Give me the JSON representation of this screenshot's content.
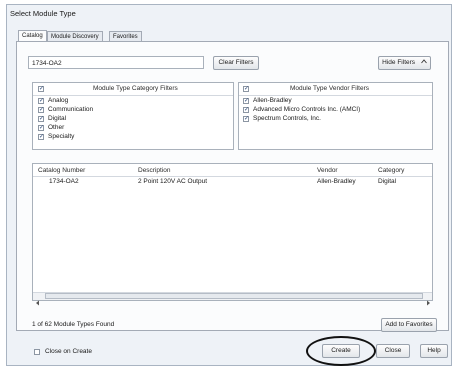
{
  "window": {
    "title": "Select Module Type"
  },
  "tabs": [
    "Catalog",
    "Module Discovery",
    "Favorites"
  ],
  "search": {
    "value": "1734-OA2"
  },
  "buttons": {
    "clear_filters": "Clear Filters",
    "hide_filters": "Hide Filters",
    "add_to_favorites": "Add to Favorites",
    "create": "Create",
    "close": "Close",
    "help": "Help"
  },
  "category_filters": {
    "header": "Module Type Category Filters",
    "items": [
      {
        "label": "Analog",
        "checked": true
      },
      {
        "label": "Communication",
        "checked": true
      },
      {
        "label": "Digital",
        "checked": true
      },
      {
        "label": "Other",
        "checked": true
      },
      {
        "label": "Specialty",
        "checked": true
      }
    ]
  },
  "vendor_filters": {
    "header": "Module Type Vendor Filters",
    "items": [
      {
        "label": "Allen-Bradley",
        "checked": true
      },
      {
        "label": "Advanced Micro Controls Inc. (AMCI)",
        "checked": true
      },
      {
        "label": "Spectrum Controls, Inc.",
        "checked": true
      }
    ]
  },
  "table": {
    "columns": [
      "Catalog Number",
      "Description",
      "Vendor",
      "Category"
    ],
    "rows": [
      [
        "1734-OA2",
        "2 Point 120V AC Output",
        "Allen-Bradley",
        "Digital"
      ]
    ]
  },
  "status": "1 of 62 Module Types Found",
  "close_on_create": {
    "label": "Close on Create",
    "checked": false
  },
  "icons": {
    "hide_filters_chevron": "chevron-up-icon",
    "scroll_left": "arrow-left-icon",
    "scroll_right": "arrow-right-icon"
  }
}
